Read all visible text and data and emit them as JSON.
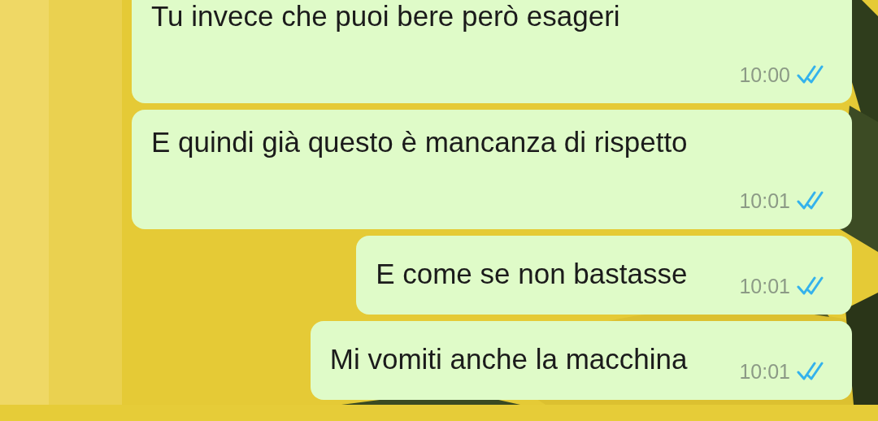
{
  "messages": [
    {
      "kind": "stacked",
      "text": "Tu invece che puoi bere però esageri",
      "time": "10:00",
      "read": true
    },
    {
      "kind": "stacked",
      "text": "E quindi già questo è mancanza di rispetto",
      "time": "10:01",
      "read": true
    },
    {
      "kind": "inline",
      "text": "E come se non bastasse",
      "time": "10:01",
      "read": true
    },
    {
      "kind": "inline",
      "text": "Mi vomiti anche la macchina",
      "time": "10:01",
      "read": true
    }
  ]
}
